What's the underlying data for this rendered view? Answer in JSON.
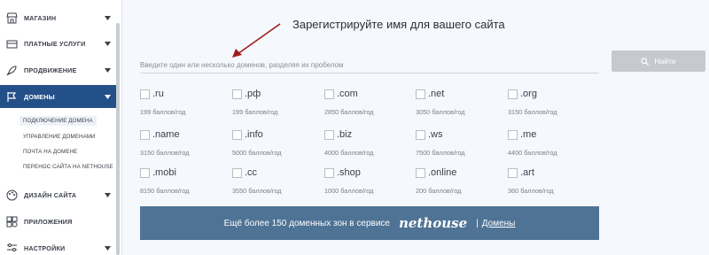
{
  "sidebar": {
    "items": [
      {
        "label": "Магазин",
        "icon": "shop-icon"
      },
      {
        "label": "Платные услуги",
        "icon": "card-icon"
      },
      {
        "label": "Продвижение",
        "icon": "rocket-icon"
      },
      {
        "label": "Домены",
        "icon": "flag-icon",
        "active": true
      },
      {
        "label": "Дизайн сайта",
        "icon": "palette-icon"
      },
      {
        "label": "Приложения",
        "icon": "apps-icon"
      },
      {
        "label": "Настройки",
        "icon": "sliders-icon"
      }
    ],
    "sub_items": [
      {
        "label": "Подключение домена"
      },
      {
        "label": "Управление доменами"
      },
      {
        "label": "Почта на домене"
      },
      {
        "label": "Перенос сайта на Nethouse"
      }
    ]
  },
  "main": {
    "title": "Зарегистрируйте имя для вашего сайта",
    "search_placeholder": "Введите один или несколько доменов, разделяя их пробелом",
    "find_button": "Найти",
    "domains": [
      {
        "name": ".ru",
        "price": "199 баллов/год"
      },
      {
        "name": ".рф",
        "price": "199 баллов/год"
      },
      {
        "name": ".com",
        "price": "2850 баллов/год"
      },
      {
        "name": ".net",
        "price": "3050 баллов/год"
      },
      {
        "name": ".org",
        "price": "3150 баллов/год"
      },
      {
        "name": ".name",
        "price": "3150 баллов/год"
      },
      {
        "name": ".info",
        "price": "5000 баллов/год"
      },
      {
        "name": ".biz",
        "price": "4000 баллов/год"
      },
      {
        "name": ".ws",
        "price": "7500 баллов/год"
      },
      {
        "name": ".me",
        "price": "4400 баллов/год"
      },
      {
        "name": ".mobi",
        "price": "8150 баллов/год"
      },
      {
        "name": ".cc",
        "price": "3550 баллов/год"
      },
      {
        "name": ".shop",
        "price": "1000 баллов/год"
      },
      {
        "name": ".online",
        "price": "200 баллов/год"
      },
      {
        "name": ".art",
        "price": "360 баллов/год"
      }
    ],
    "banner": {
      "text": "Ещё более 150 доменных зон в сервисе",
      "logo": "nethouse",
      "separator": "|",
      "link": "Домены"
    }
  },
  "colors": {
    "sidebar_active": "#245089",
    "banner_bg": "#4f7395",
    "find_button_bg": "#c6c9ce",
    "arrow": "#a01c1c"
  }
}
